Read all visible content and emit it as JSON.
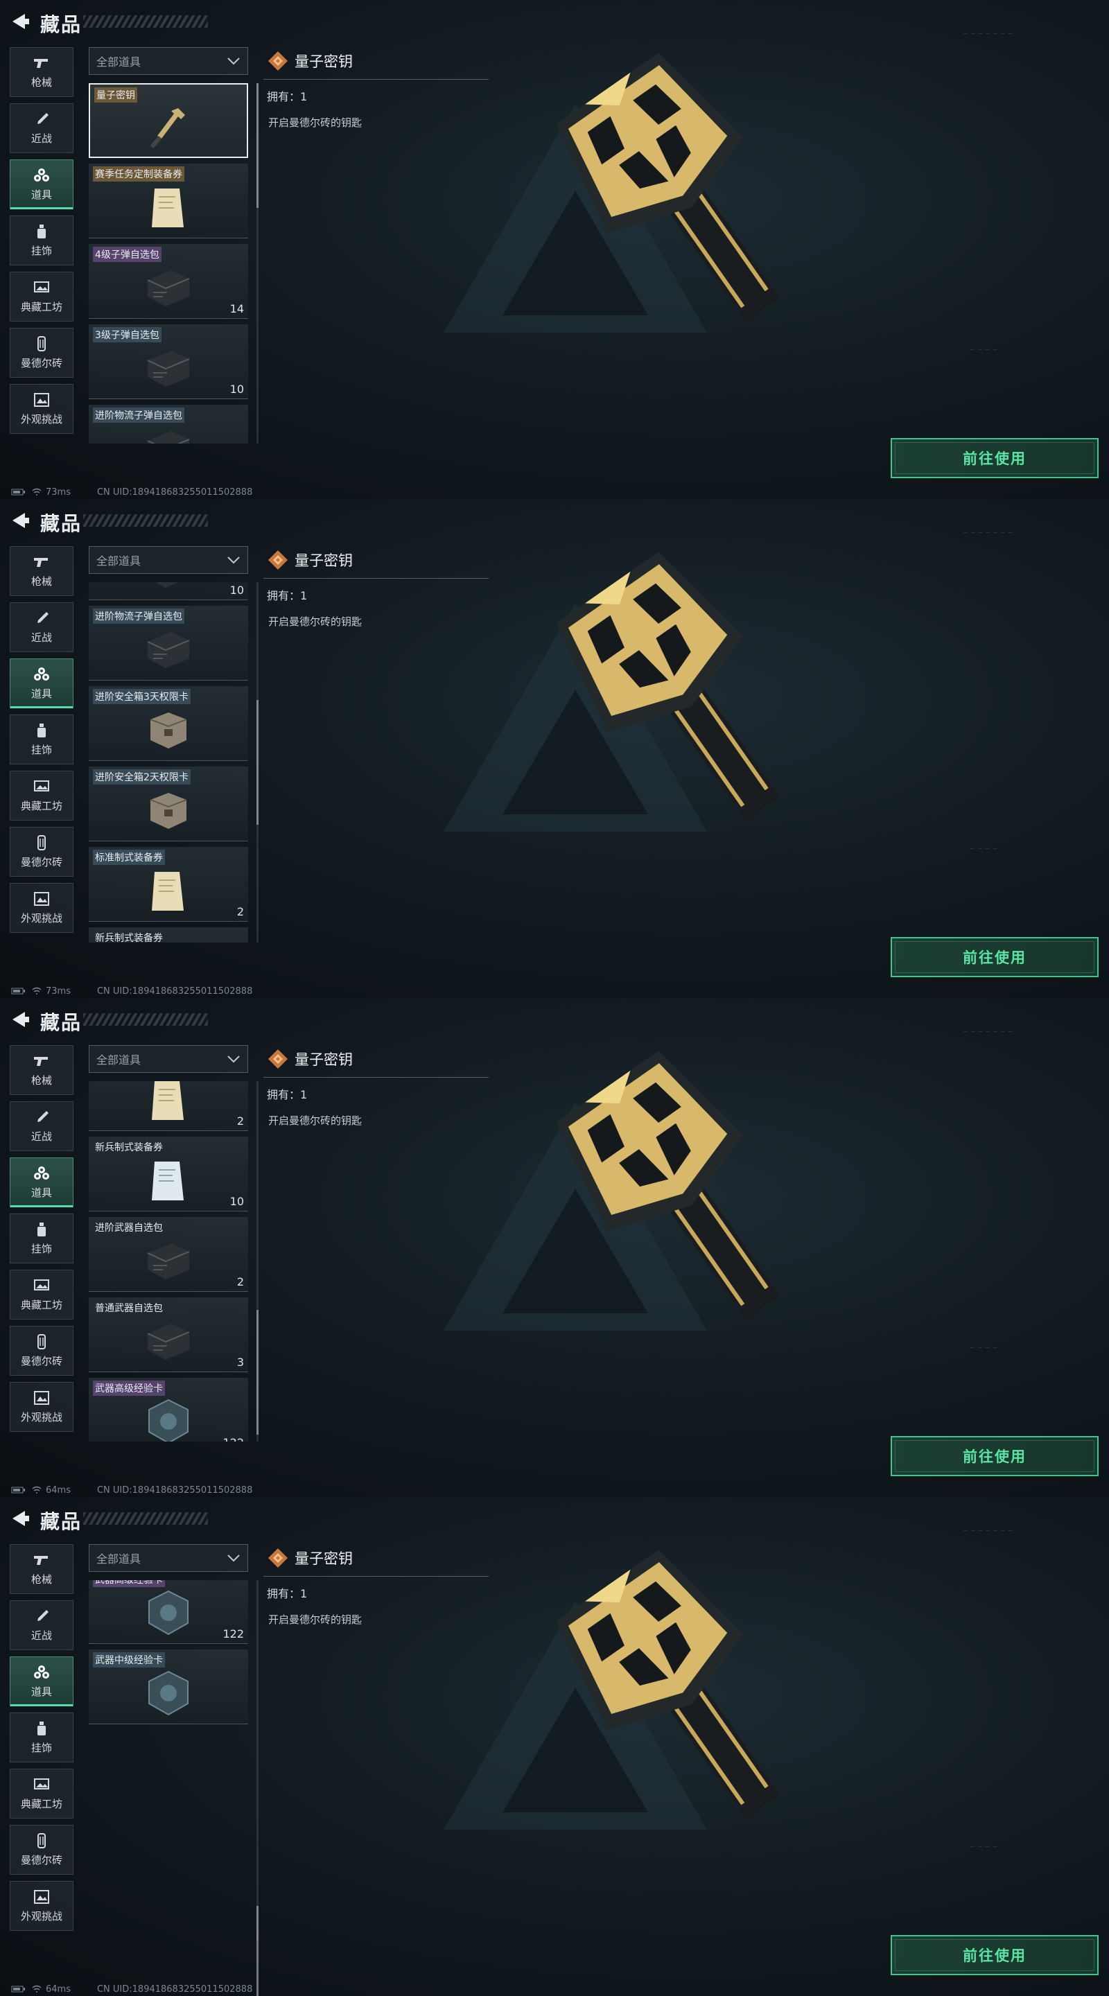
{
  "frames": [
    {
      "header": {
        "title": "藏品"
      },
      "sidebar": [
        "枪械",
        "近战",
        "道具",
        "挂饰",
        "典藏工坊",
        "曼德尔砖",
        "外观挑战"
      ],
      "filter": {
        "value": "全部道具"
      },
      "list_offset": 0,
      "scroll_thumb_top": 0,
      "detail": {
        "title": "量子密钥",
        "owned": "拥有：1",
        "desc": "开启曼德尔砖的钥匙"
      },
      "use_button": "前往使用",
      "status": {
        "ping": "73ms",
        "uid": "CN UID:18941868325501150​2888"
      }
    },
    {
      "header": {
        "title": "藏品"
      },
      "sidebar": [
        "枪械",
        "近战",
        "道具",
        "挂饰",
        "典藏工坊",
        "曼德尔砖",
        "外观挑战"
      ],
      "filter": {
        "value": "全部道具"
      },
      "list_offset": 0,
      "scroll_thumb_top": 0,
      "detail": {
        "title": "量子密钥",
        "owned": "拥有：1",
        "desc": "开启曼德尔砖的钥匙"
      },
      "use_button": "前往使用",
      "status": {
        "ping": "73ms",
        "uid": "CN UID:1894186832550115​02888"
      }
    },
    {
      "header": {
        "title": "藏品"
      },
      "sidebar": [
        "枪械",
        "近战",
        "道具",
        "挂饰",
        "典藏工坊",
        "曼德尔砖",
        "外观挑战"
      ],
      "filter": {
        "value": "全部道具"
      },
      "list_offset": 0,
      "scroll_thumb_top": 0,
      "detail": {
        "title": "量子密钥",
        "owned": "拥有：1",
        "desc": "开启曼德尔砖的钥匙"
      },
      "use_button": "前往使用",
      "status": {
        "ping": "64ms",
        "uid": "CN UID:189418683255011502888"
      }
    },
    {
      "header": {
        "title": "藏品"
      },
      "sidebar": [
        "枪械",
        "近战",
        "道具",
        "挂饰",
        "典藏工坊",
        "曼德尔砖",
        "外观挑战"
      ],
      "filter": {
        "value": "全部道具"
      },
      "list_offset": 0,
      "scroll_thumb_top": 0,
      "detail": {
        "title": "量子密钥",
        "owned": "拥有：1",
        "desc": "开启曼德尔砖的钥匙"
      },
      "use_button": "前往使用",
      "status": {
        "ping": "64ms",
        "uid": "CN UID:189418683255011502888"
      }
    }
  ],
  "items": [
    {
      "name": "量子密钥",
      "count": "",
      "tag": "gold",
      "thumb": "key"
    },
    {
      "name": "赛季任务定制装备券",
      "count": "",
      "tag": "gold",
      "thumb": "paper-gold"
    },
    {
      "name": "4级子弹自选包",
      "count": "14",
      "tag": "purple",
      "thumb": "case"
    },
    {
      "name": "3级子弹自选包",
      "count": "10",
      "tag": "blue",
      "thumb": "case"
    },
    {
      "name": "进阶物流子弹自选包",
      "count": "",
      "tag": "blue",
      "thumb": "case"
    },
    {
      "name": "进阶安全箱3天权限卡",
      "count": "",
      "tag": "blue",
      "thumb": "box"
    },
    {
      "name": "进阶安全箱2天权限卡",
      "count": "",
      "tag": "blue",
      "thumb": "box"
    },
    {
      "name": "标准制式装备券",
      "count": "2",
      "tag": "blue",
      "thumb": "paper-gold"
    },
    {
      "name": "新兵制式装备券",
      "count": "10",
      "tag": "plain",
      "thumb": "paper-blue"
    },
    {
      "name": "进阶武器自选包",
      "count": "2",
      "tag": "plain",
      "thumb": "case"
    },
    {
      "name": "普通武器自选包",
      "count": "3",
      "tag": "plain",
      "thumb": "case"
    },
    {
      "name": "武器高级经验卡",
      "count": "122",
      "tag": "purple",
      "thumb": "chip"
    },
    {
      "name": "武器中级经验卡",
      "count": "",
      "tag": "blue",
      "thumb": "chip"
    }
  ]
}
